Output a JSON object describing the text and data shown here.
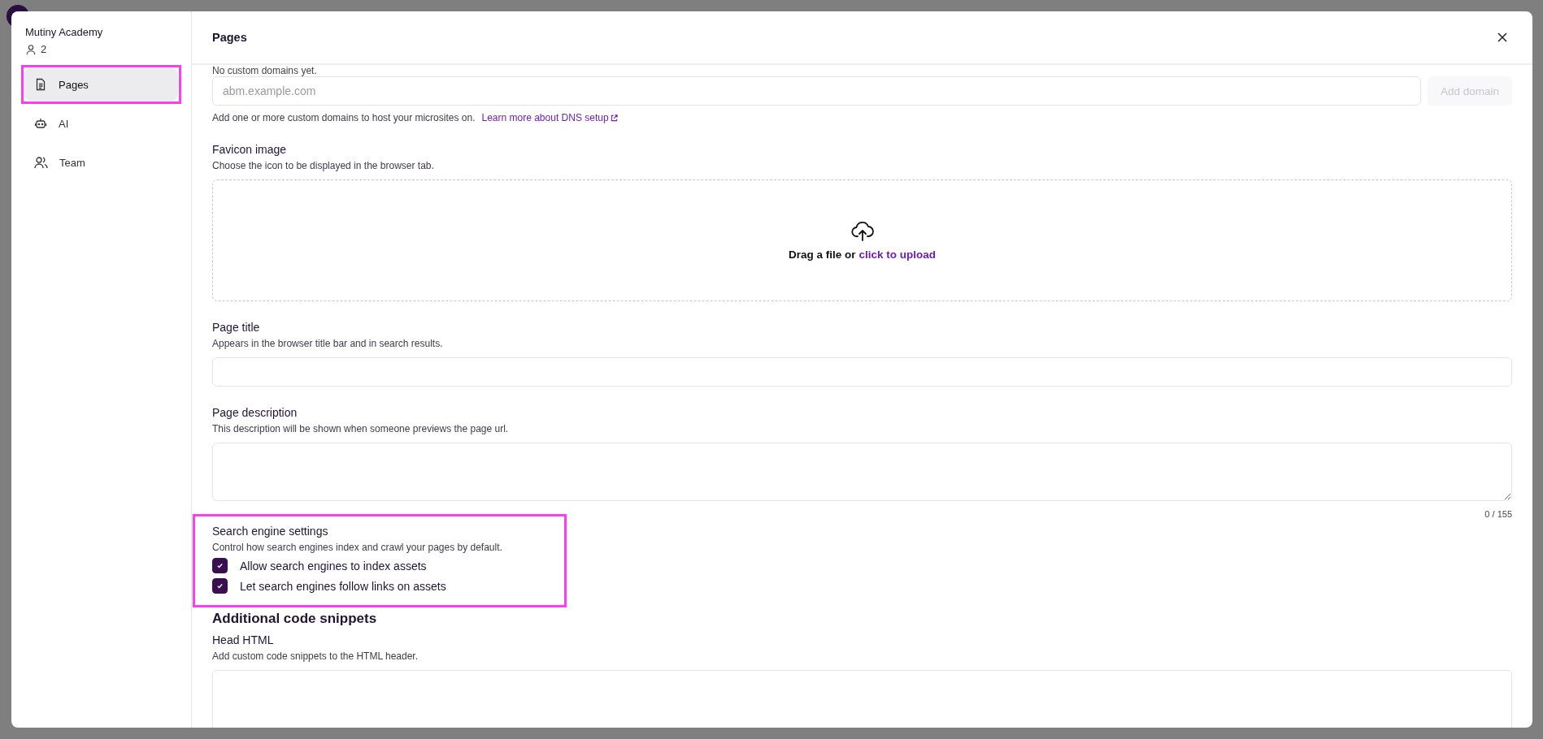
{
  "workspace": {
    "name": "Mutiny Academy",
    "member_count": "2"
  },
  "nav": [
    {
      "label": "Pages",
      "kind": "page",
      "selected": true
    },
    {
      "label": "AI",
      "kind": "robot",
      "selected": false
    },
    {
      "label": "Team",
      "kind": "people",
      "selected": false
    }
  ],
  "header": {
    "title": "Pages"
  },
  "domains": {
    "empty_note": "No custom domains yet.",
    "placeholder": "abm.example.com",
    "add_button": "Add domain",
    "add_disabled": true,
    "help": "Add one or more custom domains to host your microsites on.",
    "help_link": "Learn more about DNS setup"
  },
  "favicon": {
    "label": "Favicon image",
    "help": "Choose the icon to be displayed in the browser tab.",
    "drop_text": "Drag a file or",
    "drop_link": "click to upload"
  },
  "page_title": {
    "label": "Page title",
    "help": "Appears in the browser title bar and in search results."
  },
  "page_description": {
    "label": "Page description",
    "help": "This description will be shown when someone previews the page url.",
    "counter": "0 / 155"
  },
  "search_engine": {
    "label": "Search engine settings",
    "help": "Control how search engines index and crawl your pages by default.",
    "options": [
      {
        "label": "Allow search engines to index assets",
        "checked": true
      },
      {
        "label": "Let search engines follow links on assets",
        "checked": true
      }
    ]
  },
  "code_snippets": {
    "heading": "Additional code snippets",
    "head_label": "Head HTML",
    "head_help": "Add custom code snippets to the HTML header."
  }
}
